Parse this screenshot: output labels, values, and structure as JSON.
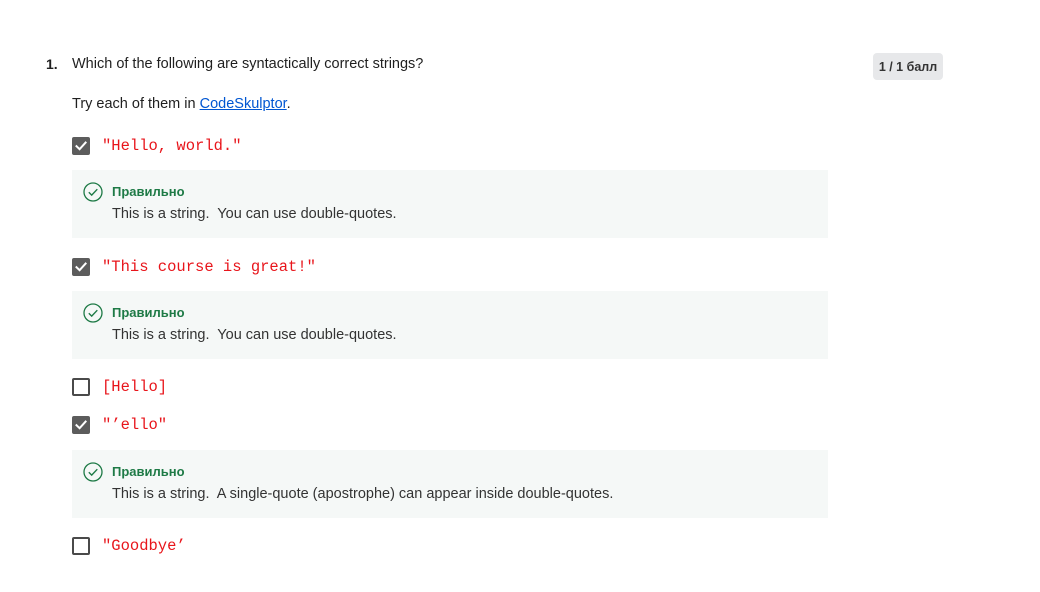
{
  "question": {
    "number": "1.",
    "text": "Which of the following are syntactically correct strings?",
    "hint_prefix": "Try each of them in ",
    "hint_link": "CodeSkulptor",
    "hint_suffix": "."
  },
  "score": "1 / 1 балл",
  "options": [
    {
      "code": "\"Hello, world.\"",
      "checked": true
    },
    {
      "code": "\"This course is great!\"",
      "checked": true
    },
    {
      "code": "[Hello]",
      "checked": false
    },
    {
      "code": "\"’ello\"",
      "checked": true
    },
    {
      "code": "\"Goodbye’",
      "checked": false
    }
  ],
  "feedback": [
    {
      "status": "Правильно",
      "text": "This is a string.  You can use double-quotes."
    },
    {
      "status": "Правильно",
      "text": "This is a string.  You can use double-quotes."
    },
    {
      "status": "Правильно",
      "text": "This is a string.  A single-quote (apostrophe) can appear inside double-quotes."
    }
  ],
  "colors": {
    "code": "#e8151b",
    "correct": "#1e7a46",
    "link": "#0056d2",
    "feedback_bg": "#f5f8f7"
  }
}
